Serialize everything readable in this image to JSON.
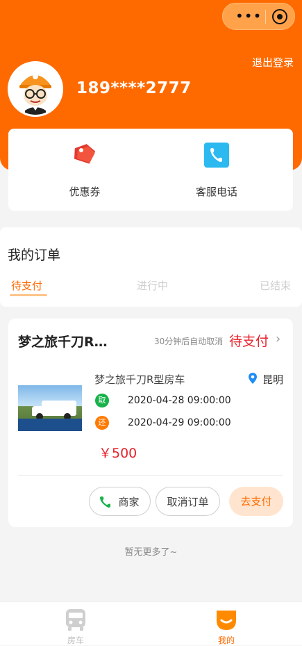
{
  "capsule": {
    "more_icon": "more-dots-icon",
    "close_icon": "target-circle-icon"
  },
  "header": {
    "logout": "退出登录",
    "phone": "189****2777",
    "avatar_icon": "cartoon-avatar-icon",
    "bg_color": "#ff6a00"
  },
  "quick": [
    {
      "label": "优惠券",
      "icon": "coupon-tag-icon",
      "color": "#f2543d"
    },
    {
      "label": "客服电话",
      "icon": "phone-icon",
      "color": "#2bb9f0"
    }
  ],
  "orders": {
    "title": "我的订单",
    "tabs": [
      {
        "label": "待支付",
        "active": true
      },
      {
        "label": "进行中",
        "active": false
      },
      {
        "label": "已结束",
        "active": false
      }
    ]
  },
  "order": {
    "shop": "梦之旅千刀R…",
    "auto_cancel": "30分钟后自动取消",
    "status": "待支付",
    "vehicle": "梦之旅千刀R型房车",
    "city": "昆明",
    "pick_badge": "取",
    "pickup": "2020-04-28 09:00:00",
    "return_badge": "还",
    "return": "2020-04-29 09:00:00",
    "price": "￥500",
    "buttons": {
      "merchant": "商家",
      "cancel": "取消订单",
      "pay": "去支付"
    }
  },
  "footer_note": "暂无更多了~",
  "tabbar": [
    {
      "label": "房车",
      "icon": "bus-icon",
      "active": false
    },
    {
      "label": "我的",
      "icon": "smile-face-icon",
      "active": true
    }
  ]
}
